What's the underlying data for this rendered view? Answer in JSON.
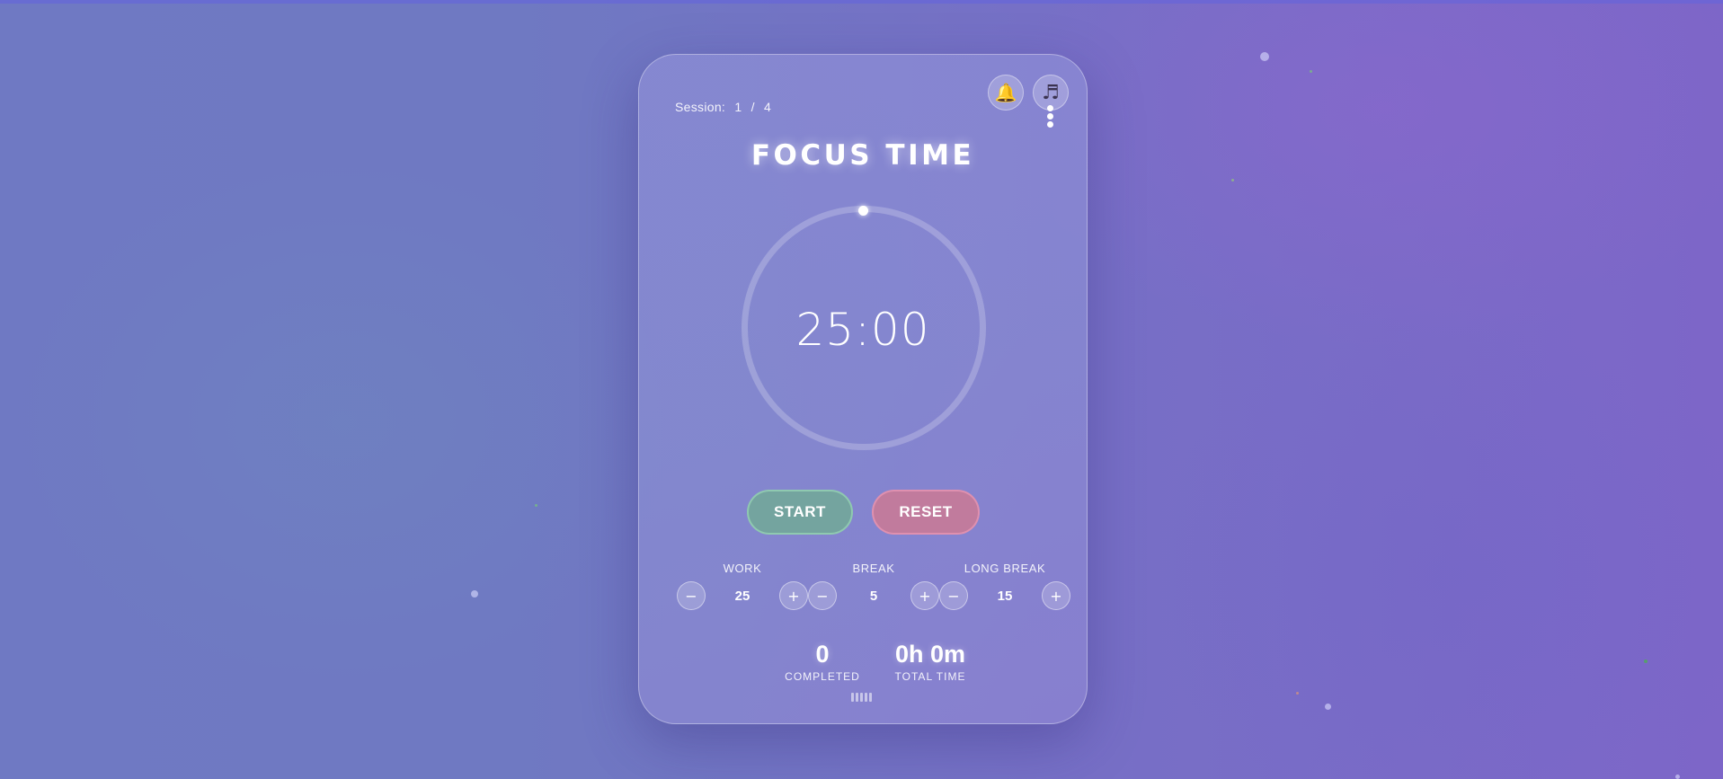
{
  "app": {
    "session_label": "Session:",
    "session_current": "1",
    "session_separator": "/",
    "session_total": "4",
    "mode_title": "FOCUS TIME",
    "timer": "25:00",
    "accent_colors": {
      "start": "#74a49f",
      "reset": "#c17b9d",
      "bell": "#e0b04a"
    }
  },
  "icons": {
    "notifications": "bell-icon",
    "sound": "music-note-icon"
  },
  "controls": {
    "start_label": "START",
    "reset_label": "RESET"
  },
  "settings": {
    "work": {
      "label": "WORK",
      "value": "25",
      "minus": "−",
      "plus": "+"
    },
    "break": {
      "label": "BREAK",
      "value": "5",
      "minus": "−",
      "plus": "+"
    },
    "long_break": {
      "label": "LONG BREAK",
      "value": "15",
      "minus": "−",
      "plus": "+"
    }
  },
  "stats": {
    "completed_value": "0",
    "completed_label": "COMPLETED",
    "total_value": "0h 0m",
    "total_label": "TOTAL TIME"
  },
  "progress": {
    "fraction": 0
  }
}
